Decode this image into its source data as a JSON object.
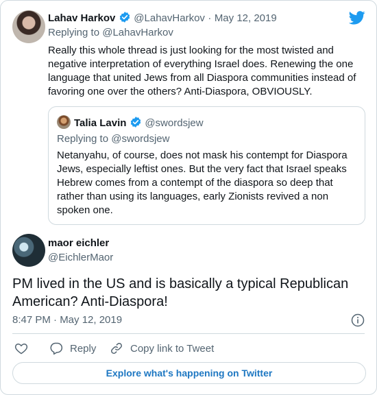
{
  "parent": {
    "name": "Lahav Harkov",
    "handle": "@LahavHarkov",
    "separator": "·",
    "date": "May 12, 2019",
    "replying_prefix": "Replying to",
    "replying_to": "@LahavHarkov",
    "text": "Really this whole thread is just looking for the most twisted and negative interpretation of everything Israel does. Renewing the one language that united Jews from all Diaspora communities instead of favoring one over the others? Anti-Diaspora, OBVIOUSLY."
  },
  "quoted": {
    "name": "Talia Lavin",
    "handle": "@swordsjew",
    "replying_prefix": "Replying to",
    "replying_to": "@swordsjew",
    "text": "Netanyahu, of course, does not mask his contempt for Diaspora Jews, especially leftist ones. But the very fact that Israel speaks Hebrew comes from a contempt of the diaspora so deep that rather than using its languages, early Zionists revived a non spoken one."
  },
  "main": {
    "name": "maor eichler",
    "handle": "@EichlerMaor",
    "text": "PM lived in the US and is basically a typical Republican American? Anti-Diaspora!",
    "time": "8:47 PM · May 12, 2019"
  },
  "actions": {
    "reply": "Reply",
    "copy": "Copy link to Tweet"
  },
  "footer": {
    "explore": "Explore what's happening on Twitter"
  },
  "colors": {
    "twitter_blue": "#1d9bf0",
    "text": "#0f1419",
    "muted": "#536471",
    "border": "#cfd9de"
  }
}
